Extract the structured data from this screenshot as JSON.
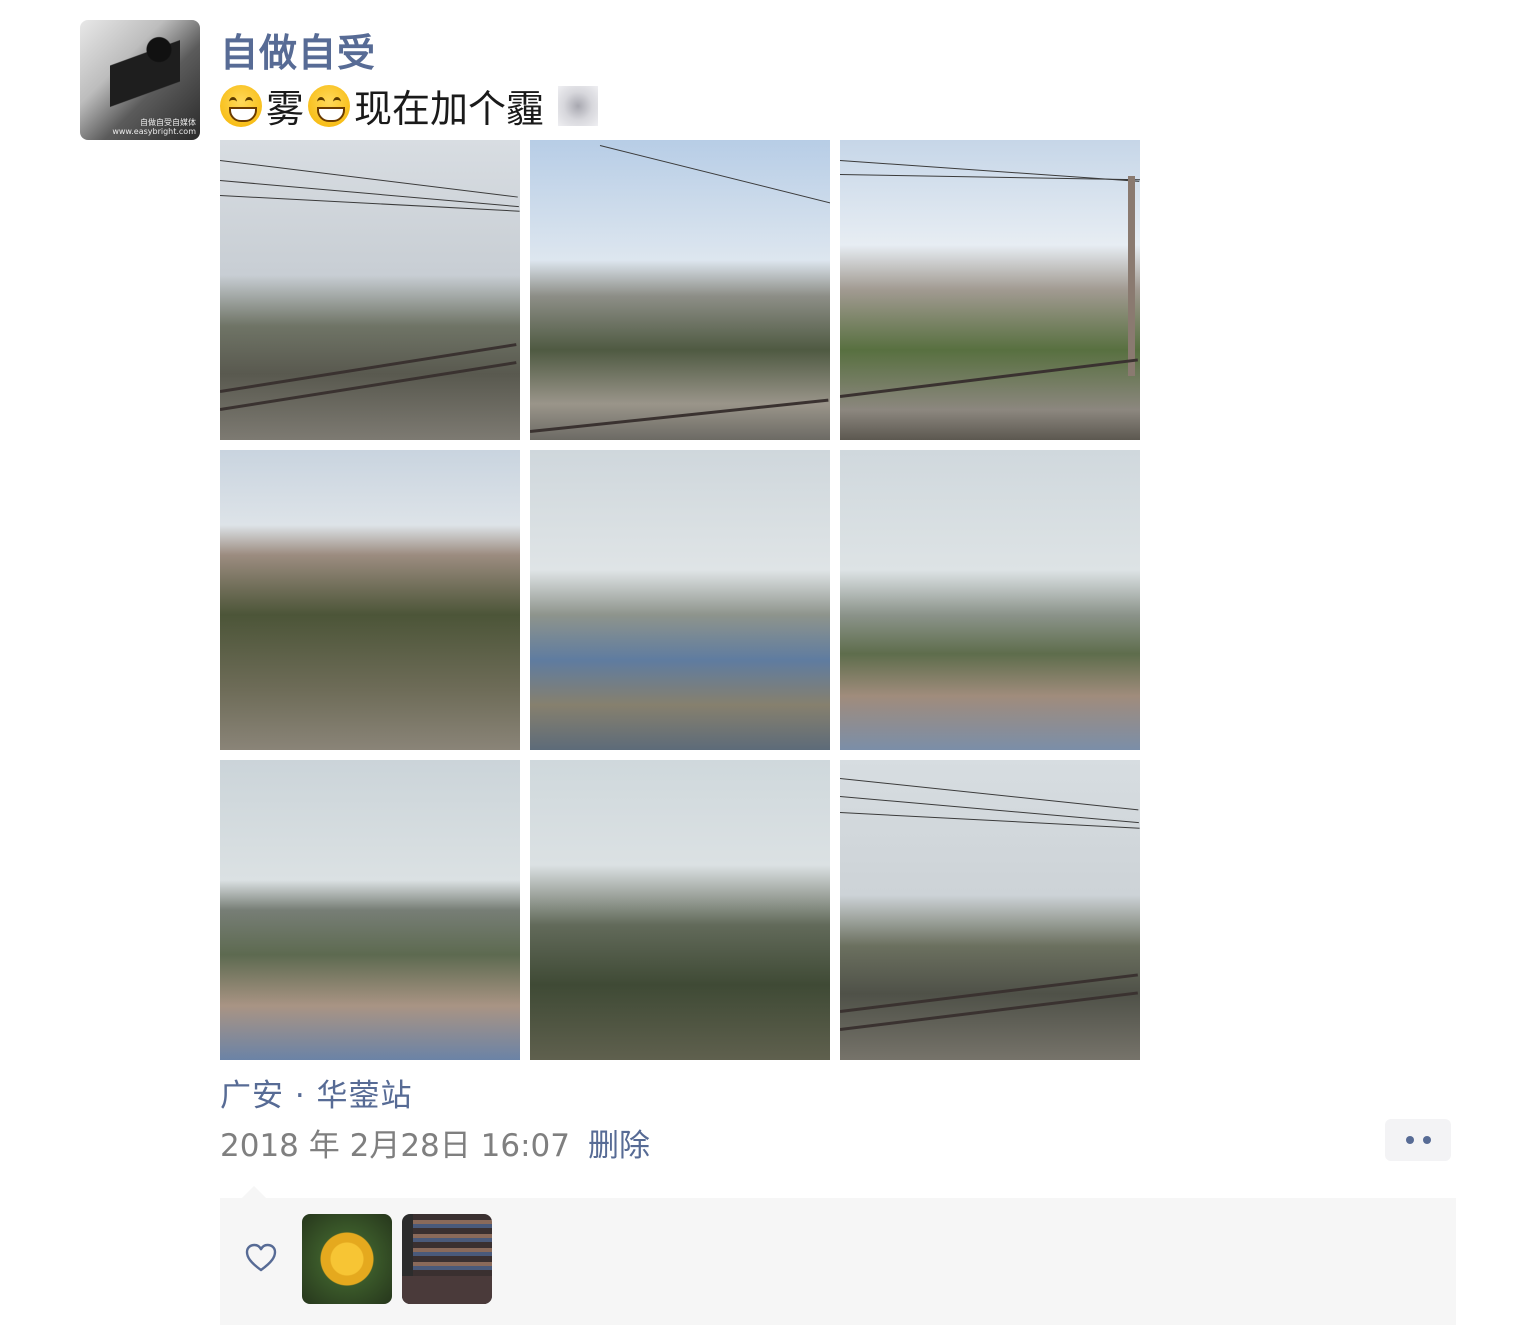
{
  "post": {
    "username": "自做自受",
    "avatar_caption": "自做自受自媒体 www.easybright.com",
    "content_parts": [
      "雾",
      "现在加个霾"
    ],
    "emoji_icon": "grinning-face-emoji",
    "photo_count": 9,
    "location": "广安 · 华蓥站",
    "timestamp": "2018 年 2月28日 16:07",
    "delete_label": "删除"
  },
  "likes": {
    "icon": "heart-outline-icon",
    "likers": [
      {
        "name": "liker-avatar-flower"
      },
      {
        "name": "liker-avatar-bookshelf"
      }
    ]
  },
  "colors": {
    "link": "#576b95",
    "meta": "#7f7f7f",
    "likes_bg": "#f6f6f6"
  }
}
